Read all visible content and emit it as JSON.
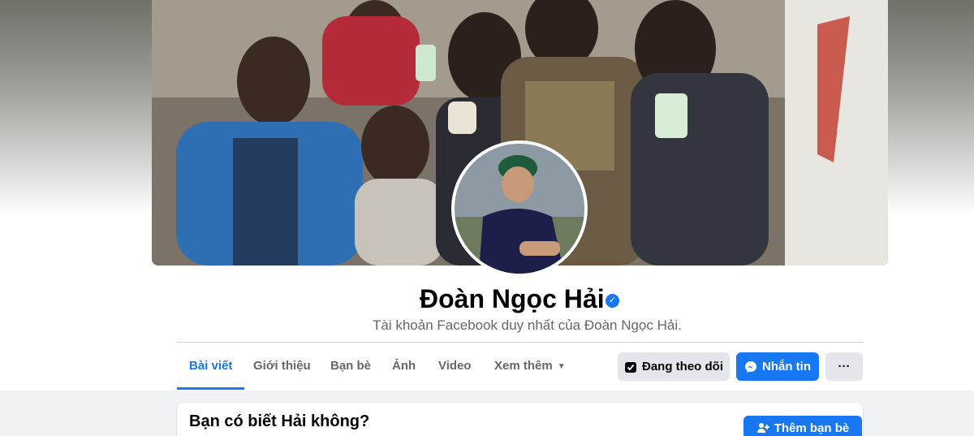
{
  "profile": {
    "name": "Đoàn Ngọc Hải",
    "bio": "Tài khoản Facebook duy nhất của Đoàn Ngọc Hải.",
    "verified": true
  },
  "tabs": [
    {
      "label": "Bài viết",
      "active": true
    },
    {
      "label": "Giới thiệu",
      "active": false
    },
    {
      "label": "Bạn bè",
      "active": false
    },
    {
      "label": "Ảnh",
      "active": false
    },
    {
      "label": "Video",
      "active": false
    },
    {
      "label": "Xem thêm",
      "active": false
    }
  ],
  "actions": {
    "follow_label": "Đang theo dõi",
    "message_label": "Nhắn tin",
    "more_label": "···"
  },
  "card": {
    "title": "Bạn có biết Hải không?",
    "add_friend_label": "Thêm bạn bè"
  },
  "colors": {
    "accent": "#1877f2",
    "secondary_text": "#65676b",
    "button_gray": "#e4e6eb"
  },
  "icons": {
    "verified": "verified-badge-icon",
    "follow": "following-icon",
    "messenger": "messenger-icon",
    "more": "more-dots-icon",
    "caret": "caret-down-icon",
    "add_friend": "add-friend-icon"
  }
}
